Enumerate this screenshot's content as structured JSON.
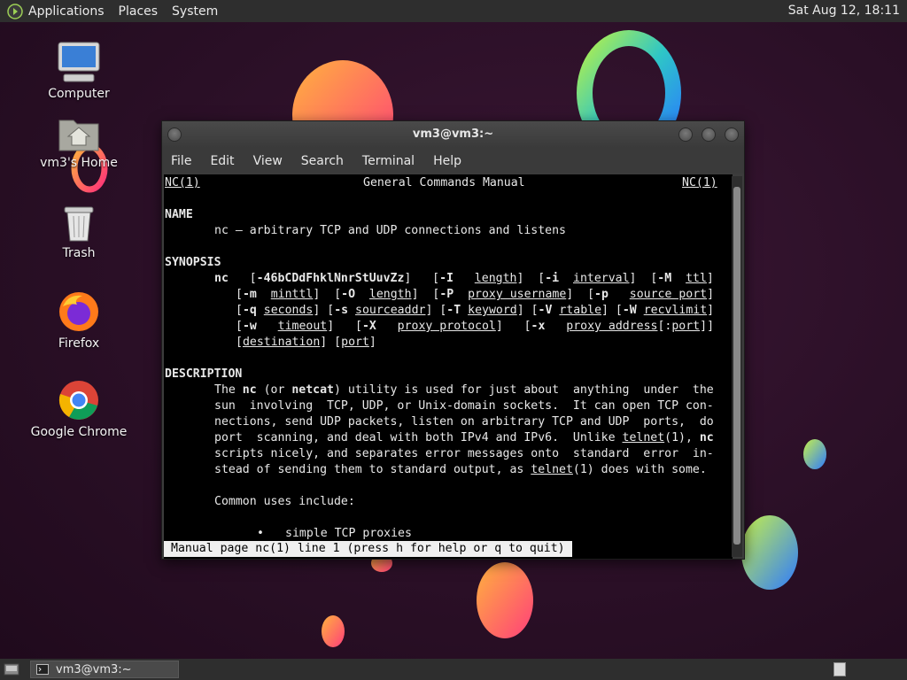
{
  "top_panel": {
    "menus": [
      "Applications",
      "Places",
      "System"
    ],
    "clock": "Sat Aug 12, 18:11"
  },
  "desktop_icons": [
    {
      "label": "Computer",
      "icon": "computer-icon"
    },
    {
      "label": "vm3's Home",
      "icon": "home-folder-icon"
    },
    {
      "label": "Trash",
      "icon": "trash-icon"
    },
    {
      "label": "Firefox",
      "icon": "firefox-icon"
    },
    {
      "label": "Google Chrome",
      "icon": "chrome-icon"
    }
  ],
  "window": {
    "title": "vm3@vm3:~",
    "menu": [
      "File",
      "Edit",
      "View",
      "Search",
      "Terminal",
      "Help"
    ]
  },
  "man": {
    "header_left": "NC(1)",
    "header_center": "General Commands Manual",
    "header_right": "NC(1)",
    "name_heading": "NAME",
    "name_line": "nc — arbitrary TCP and UDP connections and listens",
    "synopsis_heading": "SYNOPSIS",
    "description_heading": "DESCRIPTION",
    "common_uses": "Common uses include:",
    "bullet_1": "simple TCP proxies",
    "status": "Manual page nc(1) line 1 (press h for help or q to quit)"
  },
  "taskbar": {
    "item": "vm3@vm3:~"
  },
  "colors": {
    "terminal_bg": "#000000",
    "terminal_fg": "#e8e8e8",
    "panel_bg": "#2e2e2e"
  }
}
